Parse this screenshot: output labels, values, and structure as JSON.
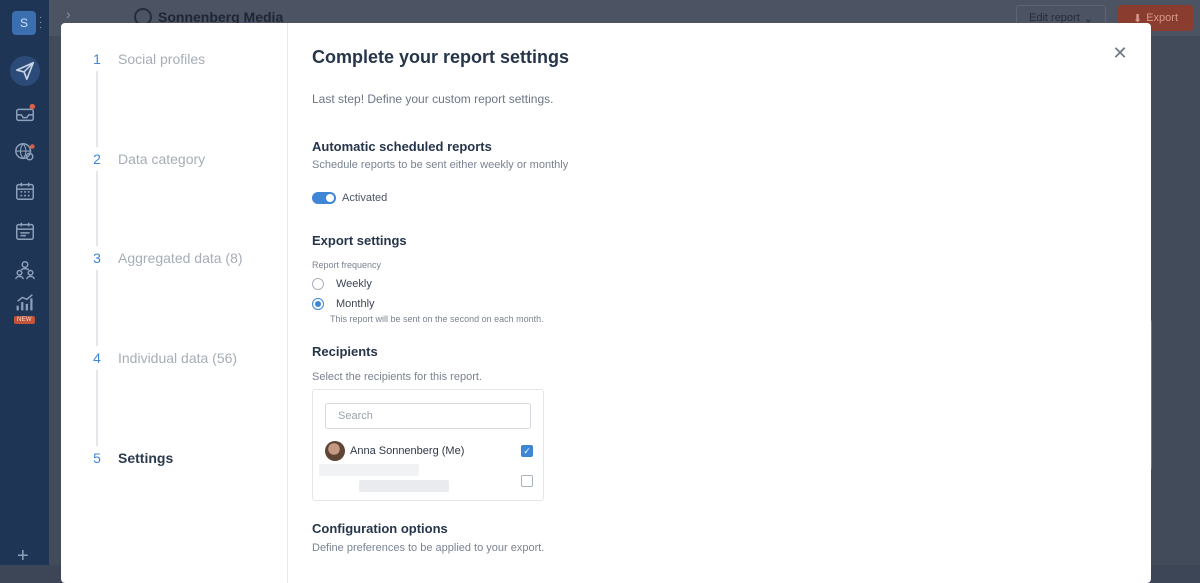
{
  "background": {
    "workspace_initial": "S",
    "brand_name": "Sonnenberg Media",
    "edit_report_label": "Edit report",
    "export_label": "Export",
    "new_tag": "NEW",
    "sidebar_icons": [
      "publish-icon",
      "inbox-icon",
      "listening-icon",
      "calendar-icon",
      "planner-icon",
      "audience-icon",
      "reports-icon"
    ]
  },
  "steps": [
    {
      "number": "1",
      "label": "Social profiles"
    },
    {
      "number": "2",
      "label": "Data category"
    },
    {
      "number": "3",
      "label": "Aggregated data (8)"
    },
    {
      "number": "4",
      "label": "Individual data (56)"
    },
    {
      "number": "5",
      "label": "Settings",
      "active": true
    }
  ],
  "content": {
    "title": "Complete your report settings",
    "subtitle": "Last step! Define your custom report settings.",
    "scheduled": {
      "title": "Automatic scheduled reports",
      "description": "Schedule reports to be sent either weekly or monthly",
      "toggle_label": "Activated",
      "toggle_on": true
    },
    "export": {
      "title": "Export settings",
      "frequency_label": "Report frequency",
      "options": [
        {
          "label": "Weekly",
          "selected": false
        },
        {
          "label": "Monthly",
          "selected": true
        }
      ],
      "note": "This report will be sent on the second on each month."
    },
    "recipients": {
      "title": "Recipients",
      "description": "Select the recipients for this report.",
      "search_placeholder": "Search",
      "list": [
        {
          "name": "Anna Sonnenberg (Me)",
          "checked": true
        }
      ]
    },
    "config": {
      "title": "Configuration options",
      "description": "Define preferences to be applied to your export."
    }
  },
  "colors": {
    "accent": "#3f86d6",
    "sidebar": "#1f3556",
    "export_button": "#8a3c2e"
  }
}
